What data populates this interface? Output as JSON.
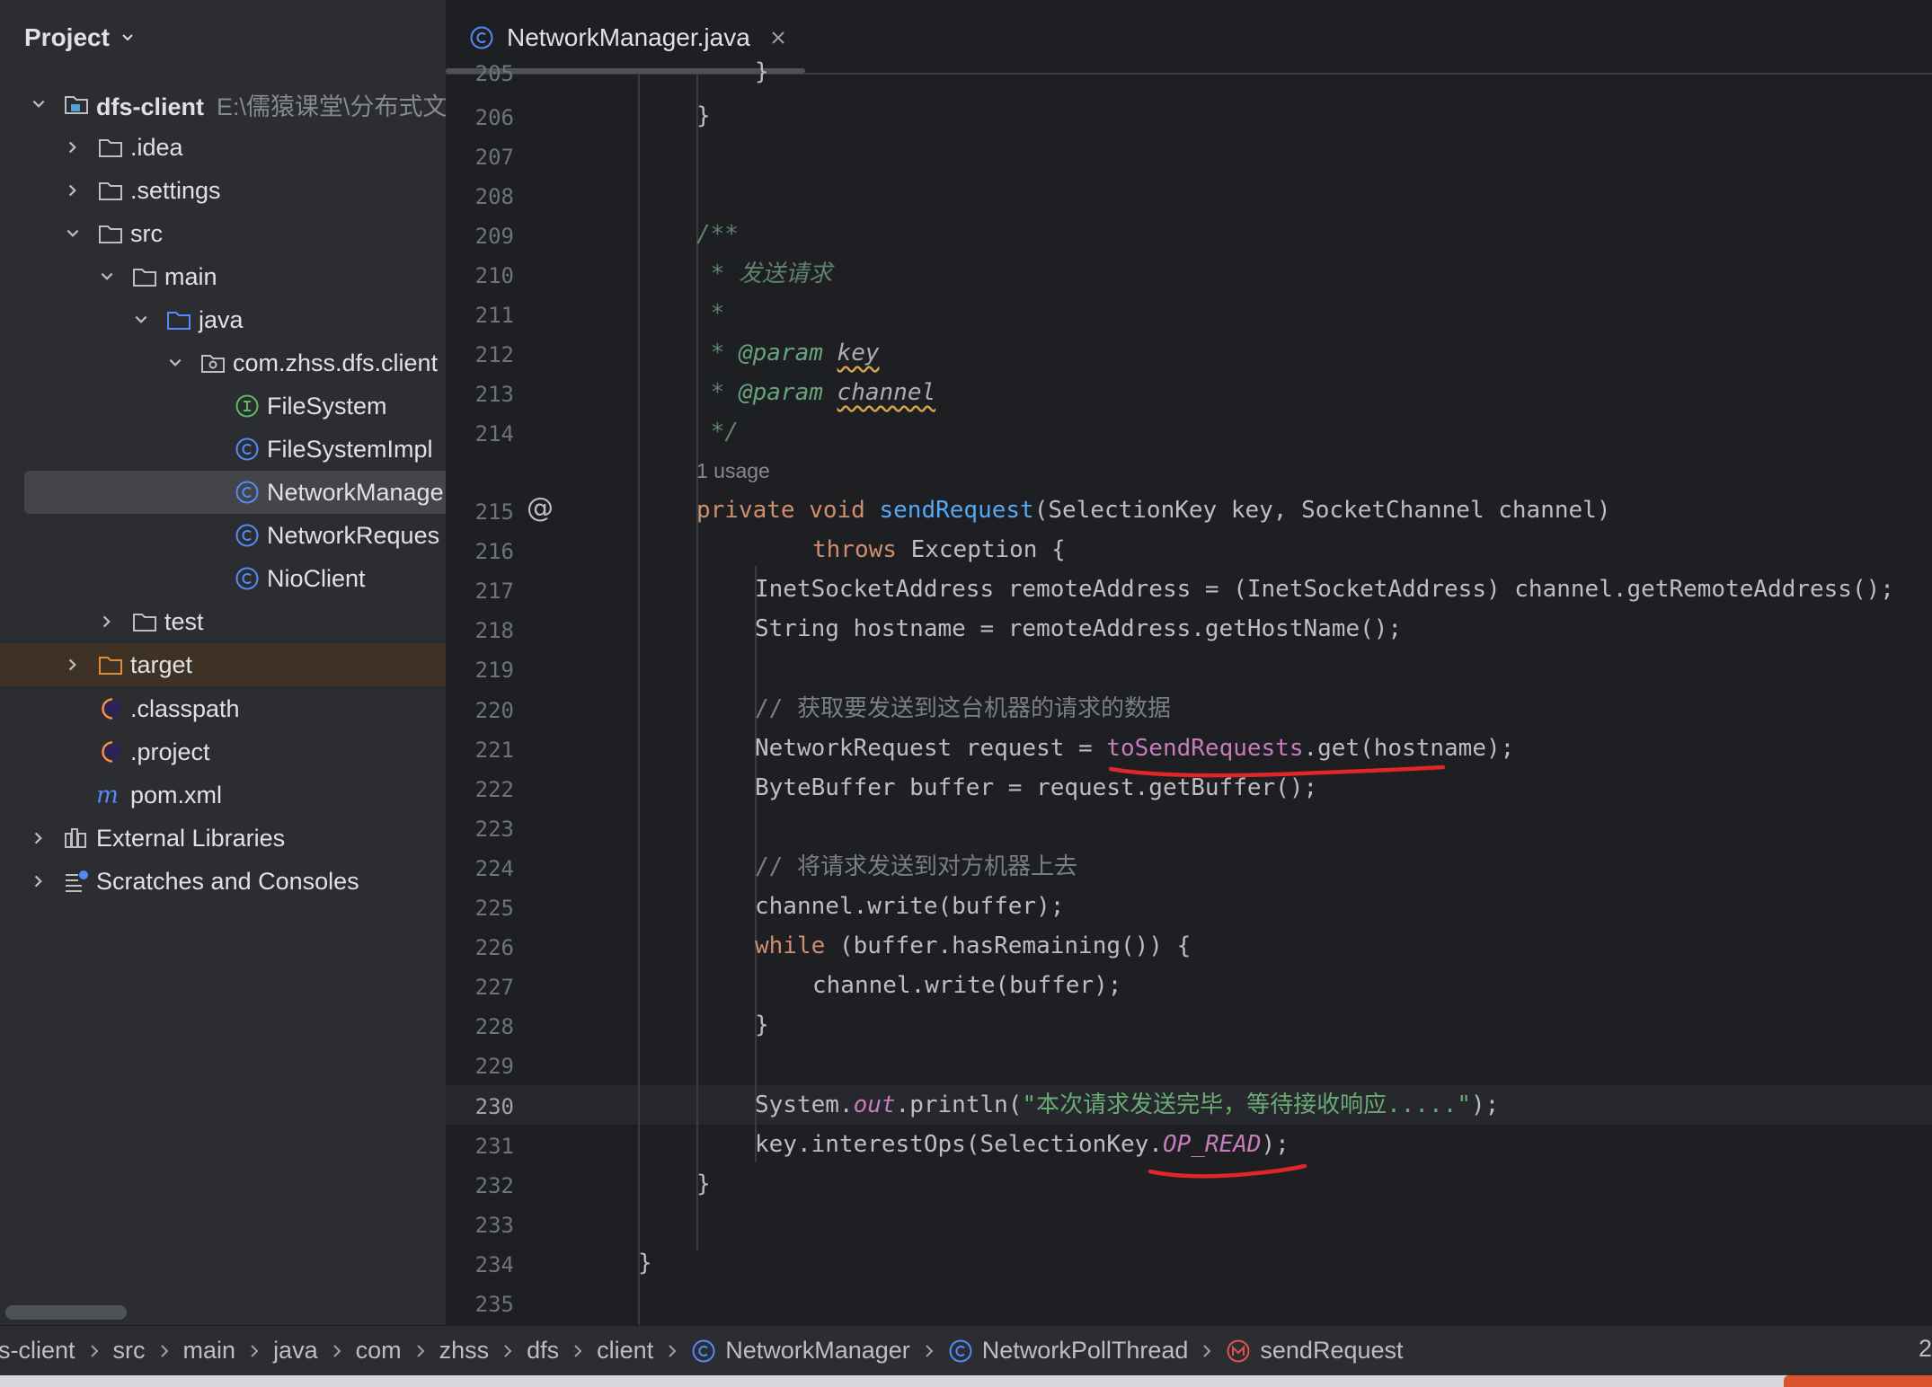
{
  "sidebar": {
    "title": "Project",
    "tree": [
      {
        "label": "dfs-client",
        "hint": "E:\\儒猿课堂\\分布式文"
      },
      {
        "label": ".idea"
      },
      {
        "label": ".settings"
      },
      {
        "label": "src"
      },
      {
        "label": "main"
      },
      {
        "label": "java"
      },
      {
        "label": "com.zhss.dfs.client"
      },
      {
        "label": "FileSystem"
      },
      {
        "label": "FileSystemImpl"
      },
      {
        "label": "NetworkManage"
      },
      {
        "label": "NetworkReques"
      },
      {
        "label": "NioClient"
      },
      {
        "label": "test"
      },
      {
        "label": "target"
      },
      {
        "label": ".classpath"
      },
      {
        "label": ".project"
      },
      {
        "label": "pom.xml"
      },
      {
        "label": "External Libraries"
      },
      {
        "label": "Scratches and Consoles"
      }
    ]
  },
  "editor": {
    "tab_label": "NetworkManager.java",
    "line_numbers": [
      "205",
      "206",
      "207",
      "208",
      "209",
      "210",
      "211",
      "212",
      "213",
      "214",
      "215",
      "216",
      "217",
      "218",
      "219",
      "220",
      "221",
      "222",
      "223",
      "224",
      "225",
      "226",
      "227",
      "228",
      "229",
      "230",
      "231",
      "232",
      "233",
      "234",
      "235"
    ],
    "usage_hint": "1 usage",
    "code": {
      "l205": "}",
      "l206": "}",
      "l209": "/**",
      "l210_star": " * ",
      "l210_text": "发送请求",
      "l211": " *",
      "l212_star": " * ",
      "l212_tag": "@param",
      "l212_name": "key",
      "l213_star": " * ",
      "l213_tag": "@param",
      "l213_name": "channel",
      "l214": " */",
      "l215_kw": "private void ",
      "l215_fn": "sendRequest",
      "l215_rest": "(SelectionKey key, SocketChannel channel)",
      "l216_kw": "throws",
      "l216_rest": " Exception {",
      "l217": "InetSocketAddress remoteAddress = (InetSocketAddress) channel.getRemoteAddress();",
      "l218": "String hostname = remoteAddress.getHostName();",
      "l220": "// 获取要发送到这台机器的请求的数据",
      "l221_a": "NetworkRequest request = ",
      "l221_fld": "toSendRequests",
      "l221_b": ".get(hostname);",
      "l222": "ByteBuffer buffer = request.getBuffer();",
      "l224": "// 将请求发送到对方机器上去",
      "l225": "channel.write(buffer);",
      "l226_kw": "while",
      "l226_rest": " (buffer.hasRemaining()) {",
      "l227": "channel.write(buffer);",
      "l228": "}",
      "l230_a": "System.",
      "l230_fld": "out",
      "l230_b": ".println(",
      "l230_str": "\"本次请求发送完毕，等待接收响应.....\"",
      "l230_c": ");",
      "l231_a": "key.interestOps(SelectionKey.",
      "l231_fld": "OP_READ",
      "l231_b": ");",
      "l232": "}",
      "l234": "}"
    }
  },
  "breadcrumbs": {
    "items": [
      "s-client",
      "src",
      "main",
      "java",
      "com",
      "zhss",
      "dfs",
      "client",
      "NetworkManager",
      "NetworkPollThread",
      "sendRequest"
    ],
    "right_text": "2"
  },
  "colors": {
    "keyword": "#cf8e6d",
    "method": "#56a8f5",
    "field": "#c77dbb",
    "string": "#6aab73",
    "doc_comment": "#5f826b",
    "annotation_red": "#e0262b",
    "class_icon": "#548af7",
    "interface_icon": "#5fb865"
  },
  "icons": {
    "tab": "class-icon",
    "tab_close": "close-icon",
    "gutter_215": "implements-at-icon"
  }
}
